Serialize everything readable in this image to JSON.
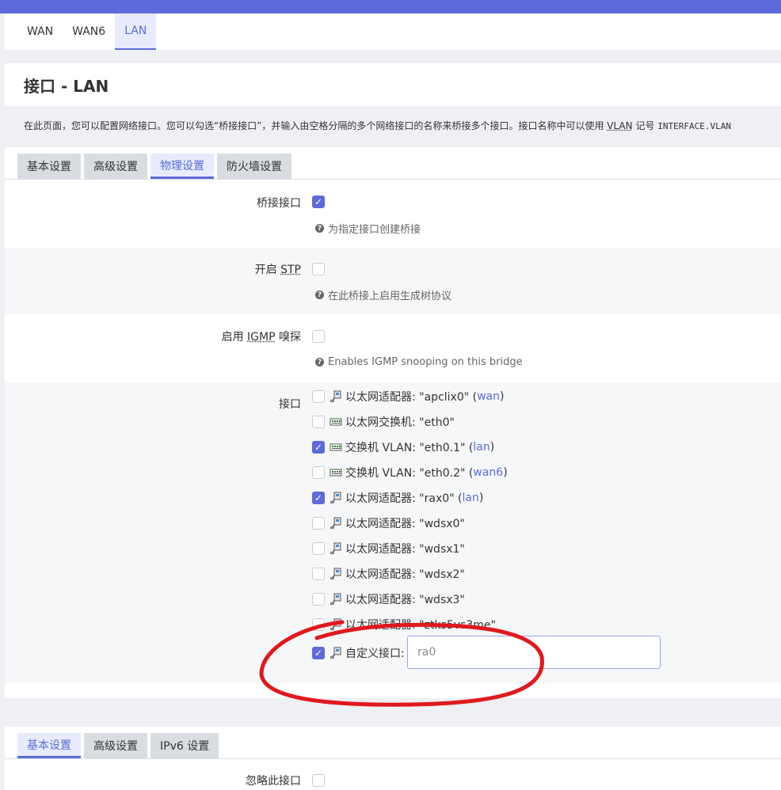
{
  "interface_tabs": [
    "WAN",
    "WAN6",
    "LAN"
  ],
  "page_title": "接口 - LAN",
  "description": {
    "part1": "在此页面，您可以配置网络接口。您可以勾选“桥接接口”，并输入由空格分隔的多个网络接口的名称来桥接多个接口。接口名称中可以使用 ",
    "vlan": "VLAN",
    "part2": " 记号 ",
    "mono": "INTERFACE.VLAN"
  },
  "section_tabs": [
    "基本设置",
    "高级设置",
    "物理设置",
    "防火墙设置"
  ],
  "rows": {
    "bridge": {
      "label": "桥接接口",
      "hint": "为指定接口创建桥接",
      "checked": true
    },
    "stp": {
      "label_prefix": "开启 ",
      "label_abbr": "STP",
      "hint": "在此桥接上启用生成树协议",
      "checked": false
    },
    "igmp": {
      "label_prefix": "启用 ",
      "label_abbr": "IGMP",
      "label_suffix": " 嗅探",
      "hint": "Enables IGMP snooping on this bridge",
      "checked": false
    }
  },
  "interfaces": {
    "label": "接口",
    "items": [
      {
        "text": "以太网适配器: \"apclix0\" (",
        "net": "wan",
        "close": ")",
        "checked": false,
        "icon": "ethernet-adapter-icon"
      },
      {
        "text": "以太网交换机: \"eth0\"",
        "net": "",
        "close": "",
        "checked": false,
        "icon": "switch-icon"
      },
      {
        "text": "交换机 VLAN: \"eth0.1\" (",
        "net": "lan",
        "close": ")",
        "checked": true,
        "icon": "switch-icon"
      },
      {
        "text": "交换机 VLAN: \"eth0.2\" (",
        "net": "wan6",
        "close": ")",
        "checked": false,
        "icon": "switch-icon"
      },
      {
        "text": "以太网适配器: \"rax0\" (",
        "net": "lan",
        "close": ")",
        "checked": true,
        "icon": "ethernet-adapter-icon"
      },
      {
        "text": "以太网适配器: \"wdsx0\"",
        "net": "",
        "close": "",
        "checked": false,
        "icon": "ethernet-adapter-icon"
      },
      {
        "text": "以太网适配器: \"wdsx1\"",
        "net": "",
        "close": "",
        "checked": false,
        "icon": "ethernet-adapter-icon"
      },
      {
        "text": "以太网适配器: \"wdsx2\"",
        "net": "",
        "close": "",
        "checked": false,
        "icon": "ethernet-adapter-icon"
      },
      {
        "text": "以太网适配器: \"wdsx3\"",
        "net": "",
        "close": "",
        "checked": false,
        "icon": "ethernet-adapter-icon"
      },
      {
        "text": "以太网适配器: \"ztks5vs3me\"",
        "net": "",
        "close": "",
        "checked": false,
        "icon": "ethernet-adapter-icon"
      }
    ],
    "custom": {
      "label": "自定义接口:",
      "value": "ra0",
      "checked": true
    }
  },
  "second_panel_tabs": [
    "基本设置",
    "高级设置",
    "IPv6 设置"
  ],
  "ignore_row_label": "忽略此接口",
  "colors": {
    "accent": "#5c6bd9",
    "annotation": "#e0191d"
  }
}
